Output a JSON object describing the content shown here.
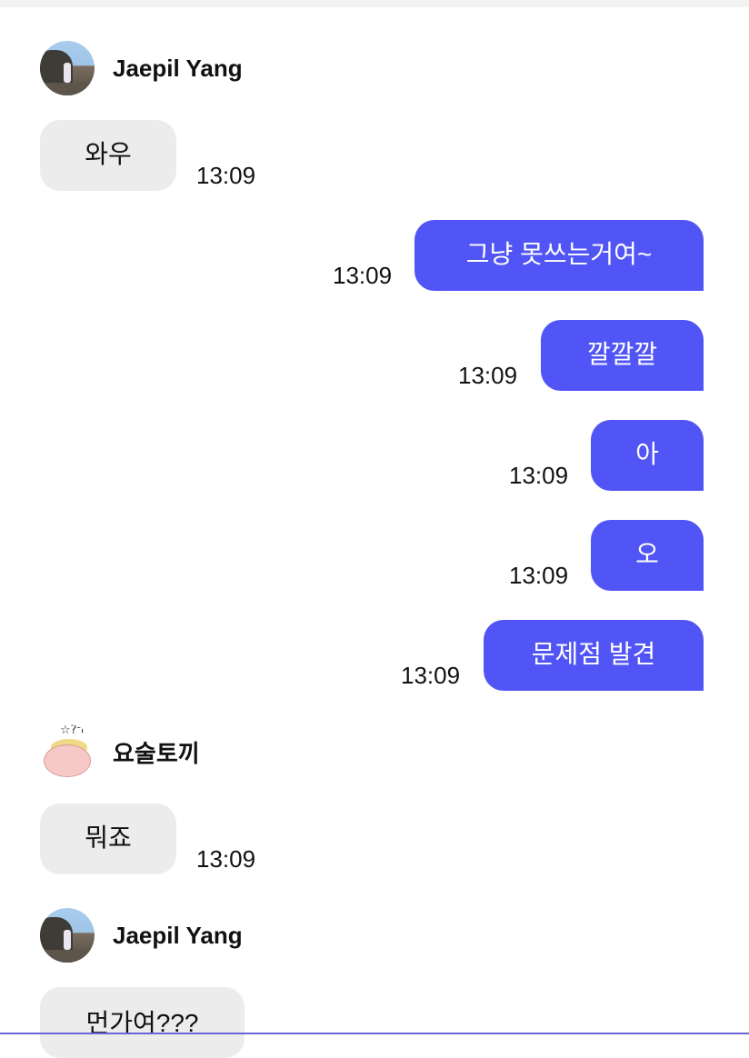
{
  "messages": [
    {
      "kind": "sender",
      "name": "Jaepil Yang",
      "avatar_icon": "user-photo-avatar-icon"
    },
    {
      "kind": "incoming",
      "text": "와우",
      "time": "13:09"
    },
    {
      "kind": "outgoing",
      "text": "그냥 못쓰는거여~",
      "time": "13:09"
    },
    {
      "kind": "outgoing",
      "text": "깔깔깔",
      "time": "13:09"
    },
    {
      "kind": "outgoing",
      "text": "아",
      "time": "13:09"
    },
    {
      "kind": "outgoing",
      "text": "오",
      "time": "13:09"
    },
    {
      "kind": "outgoing",
      "text": "문제점 발견",
      "time": "13:09"
    },
    {
      "kind": "sender",
      "name": "요술토끼",
      "avatar_icon": "rabbit-drawing-avatar-icon"
    },
    {
      "kind": "incoming",
      "text": "뭐죠",
      "time": "13:09"
    },
    {
      "kind": "sender",
      "name": "Jaepil Yang",
      "avatar_icon": "user-photo-avatar-icon"
    },
    {
      "kind": "incoming",
      "text": "먼가여???",
      "time": ""
    }
  ],
  "colors": {
    "outgoing_bubble": "#5155f5",
    "incoming_bubble": "#ececec",
    "bottom_accent": "#6c63d8"
  }
}
